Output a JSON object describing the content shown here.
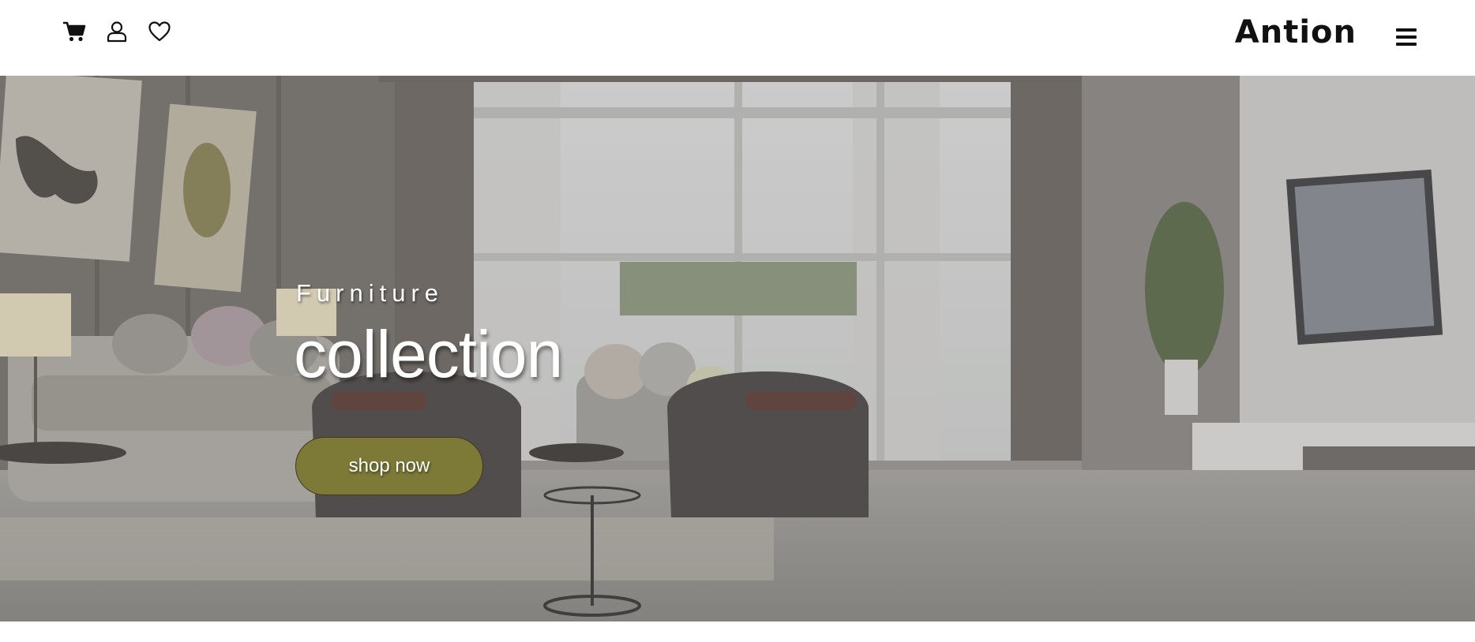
{
  "header": {
    "icons": [
      "cart-icon",
      "user-icon",
      "heart-icon"
    ],
    "brand": "Antion",
    "menu_icon": "hamburger-menu-icon"
  },
  "hero": {
    "kicker": "Furniture",
    "headline": "collection",
    "cta_label": "shop now",
    "background_image": "living-room-photo",
    "colors": {
      "cta": "#7c7a36",
      "text": "#ffffff"
    }
  }
}
